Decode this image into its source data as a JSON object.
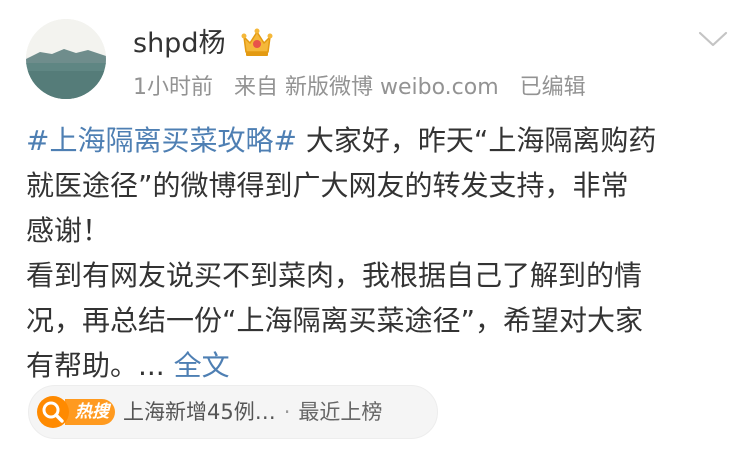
{
  "post": {
    "author": {
      "name": "shpd杨",
      "avatar_icon": "avatar-landscape-icon",
      "badge_icon": "crown-member-icon"
    },
    "meta": {
      "time": "1小时前",
      "source": "来自 新版微博 weibo.com",
      "edited": "已编辑"
    },
    "content": {
      "hashtag": "#上海隔离买菜攻略#",
      "line1_rest": " 大家好，昨天“上海隔离购药",
      "line2": "就医途径”的微博得到广大网友的转发支持，非常",
      "line3": "感谢！",
      "line4": "看到有网友说买不到菜肉，我根据自己了解到的情",
      "line5": "况，再总结一份“上海隔离买菜途径”，希望对大家",
      "line6_text": "有帮助。... ",
      "more_label": "全文"
    },
    "hot_search": {
      "badge_label": "热搜",
      "topic": "上海新增45例…",
      "separator": "·",
      "status": "最近上榜"
    }
  },
  "colors": {
    "link": "#4e7fb3",
    "text": "#333333",
    "meta": "#939393",
    "hot_orange": "#ff9a1f"
  }
}
